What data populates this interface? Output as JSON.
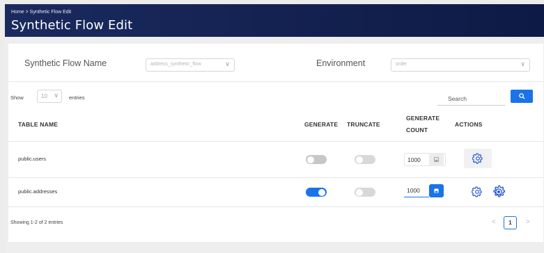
{
  "header": {
    "breadcrumb": "Home  >  Synthetic Flow Edit",
    "title": "Synthetic Flow Edit"
  },
  "form": {
    "flow_name_label": "Synthetic Flow Name",
    "flow_name_value": "address_synthetic_flow",
    "environment_label": "Environment",
    "environment_value": "order"
  },
  "table_controls": {
    "show_label": "Show",
    "entries_value": "10",
    "entries_label": "entries",
    "search_placeholder": "Search"
  },
  "columns": {
    "table_name": "TABLE NAME",
    "generate": "GENERATE",
    "truncate": "TRUNCATE",
    "generate_count_1": "GENERATE",
    "generate_count_2": "COUNT",
    "actions": "ACTIONS"
  },
  "rows": [
    {
      "table_name": "public.users",
      "generate": false,
      "truncate": false,
      "count": "1000",
      "actions": [
        "settings-gear"
      ]
    },
    {
      "table_name": "public.addresses",
      "generate": true,
      "truncate": false,
      "count": "1000",
      "actions": [
        "settings-gear",
        "settings-advanced"
      ]
    }
  ],
  "footer": {
    "summary": "Showing 1-2 of 2 entries",
    "prev": "<",
    "page": "1",
    "next": ">"
  },
  "colors": {
    "header_bg": "#142150",
    "accent": "#1a73e8",
    "toggle_off": "#c7c7c7"
  }
}
